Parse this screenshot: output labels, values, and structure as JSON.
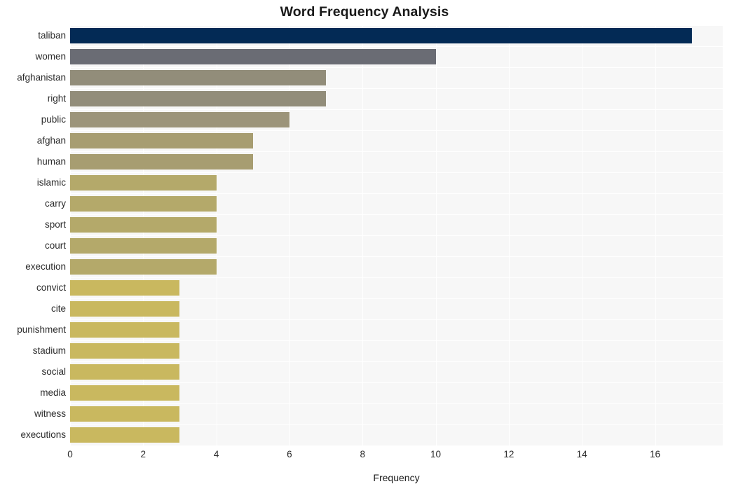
{
  "chart_data": {
    "type": "bar",
    "orientation": "horizontal",
    "title": "Word Frequency Analysis",
    "xlabel": "Frequency",
    "ylabel": "",
    "categories": [
      "taliban",
      "women",
      "afghanistan",
      "right",
      "public",
      "afghan",
      "human",
      "islamic",
      "carry",
      "sport",
      "court",
      "execution",
      "convict",
      "cite",
      "punishment",
      "stadium",
      "social",
      "media",
      "witness",
      "executions"
    ],
    "values": [
      17,
      10,
      7,
      7,
      6,
      5,
      5,
      4,
      4,
      4,
      4,
      4,
      3,
      3,
      3,
      3,
      3,
      3,
      3,
      3
    ],
    "bar_colors": [
      "#032a55",
      "#6a6c74",
      "#928d7a",
      "#928d7a",
      "#9c947a",
      "#a79d71",
      "#a79d71",
      "#b4a96a",
      "#b4a96a",
      "#b4a96a",
      "#b4a96a",
      "#b4a96a",
      "#c9b85f",
      "#c9b85f",
      "#c9b85f",
      "#c9b85f",
      "#c9b85f",
      "#c9b85f",
      "#c9b85f",
      "#c9b85f"
    ],
    "xlim": [
      0,
      17.85
    ],
    "xticks": [
      0,
      2,
      4,
      6,
      8,
      10,
      12,
      14,
      16
    ],
    "xtick_labels": [
      "0",
      "2",
      "4",
      "6",
      "8",
      "10",
      "12",
      "14",
      "16"
    ],
    "grid": {
      "vertical": true,
      "horizontal": true,
      "color": "#ffffff"
    },
    "legend": null,
    "plot_background": "#f7f7f7",
    "figure_background": "#ffffff"
  }
}
